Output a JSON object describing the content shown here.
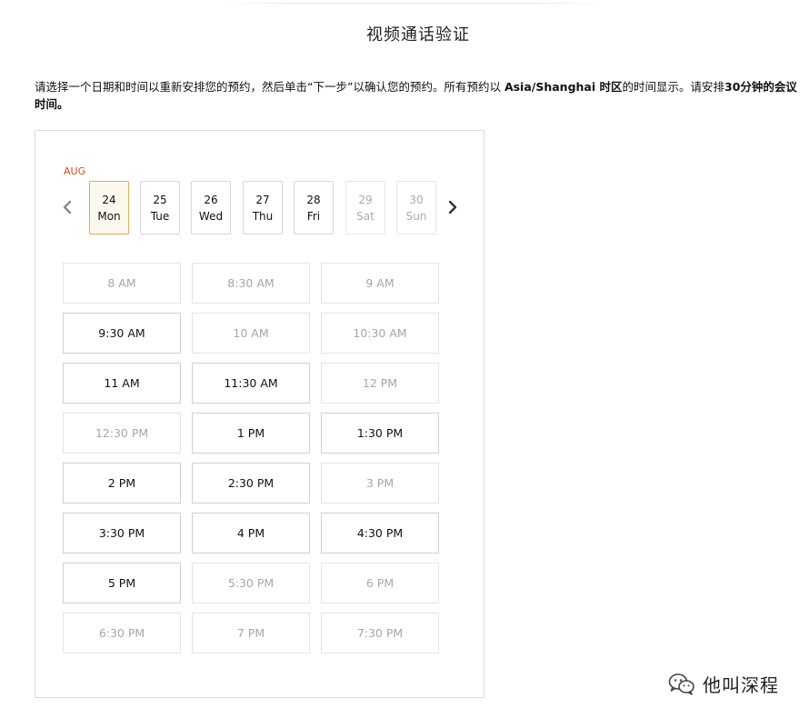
{
  "page": {
    "title": "视频通话验证",
    "instructions": {
      "part1": "请选择一个日期和时间以重新安排您的预约，然后单击“下一步”以确认您的预约。所有预约以 ",
      "timezone": "Asia/Shanghai 时区",
      "part2": "的时间显示。请安排",
      "duration": "30分钟的会议时间。"
    }
  },
  "calendar": {
    "month": "AUG",
    "prev_icon": "chevron-left-icon",
    "next_icon": "chevron-right-icon",
    "days": [
      {
        "num": "24",
        "dow": "Mon",
        "state": "selected"
      },
      {
        "num": "25",
        "dow": "Tue",
        "state": "available"
      },
      {
        "num": "26",
        "dow": "Wed",
        "state": "available"
      },
      {
        "num": "27",
        "dow": "Thu",
        "state": "available"
      },
      {
        "num": "28",
        "dow": "Fri",
        "state": "available"
      },
      {
        "num": "29",
        "dow": "Sat",
        "state": "disabled"
      },
      {
        "num": "30",
        "dow": "Sun",
        "state": "disabled"
      }
    ]
  },
  "time_slots": [
    {
      "label": "8 AM",
      "available": false
    },
    {
      "label": "8:30 AM",
      "available": false
    },
    {
      "label": "9 AM",
      "available": false
    },
    {
      "label": "9:30 AM",
      "available": true
    },
    {
      "label": "10 AM",
      "available": false
    },
    {
      "label": "10:30 AM",
      "available": false
    },
    {
      "label": "11 AM",
      "available": true
    },
    {
      "label": "11:30 AM",
      "available": true
    },
    {
      "label": "12 PM",
      "available": false
    },
    {
      "label": "12:30 PM",
      "available": false
    },
    {
      "label": "1 PM",
      "available": true
    },
    {
      "label": "1:30 PM",
      "available": true
    },
    {
      "label": "2 PM",
      "available": true
    },
    {
      "label": "2:30 PM",
      "available": true
    },
    {
      "label": "3 PM",
      "available": false
    },
    {
      "label": "3:30 PM",
      "available": true
    },
    {
      "label": "4 PM",
      "available": true
    },
    {
      "label": "4:30 PM",
      "available": true
    },
    {
      "label": "5 PM",
      "available": true
    },
    {
      "label": "5:30 PM",
      "available": false
    },
    {
      "label": "6 PM",
      "available": false
    },
    {
      "label": "6:30 PM",
      "available": false
    },
    {
      "label": "7 PM",
      "available": false
    },
    {
      "label": "7:30 PM",
      "available": false
    }
  ],
  "watermark": {
    "icon": "wechat-icon",
    "text": "他叫深程"
  },
  "colors": {
    "month_accent": "#c7511f",
    "selected_border": "#e3a85a",
    "selected_bg": "#fdf8ee"
  }
}
